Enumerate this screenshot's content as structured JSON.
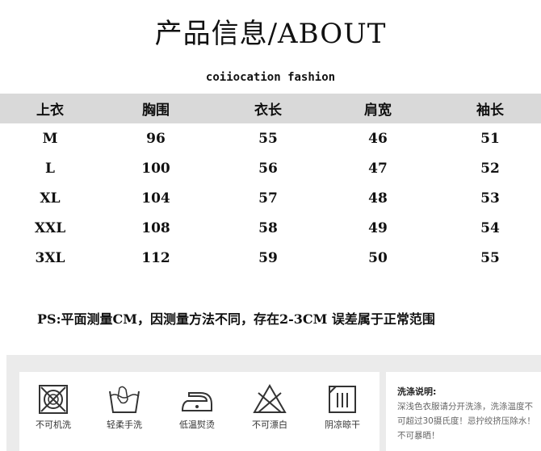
{
  "title": "产品信息/ABOUT",
  "subtitle": "coiiocation fashion",
  "table": {
    "headers": [
      "上衣",
      "胸围",
      "衣长",
      "肩宽",
      "袖长"
    ],
    "rows": [
      [
        "M",
        "96",
        "55",
        "46",
        "51"
      ],
      [
        "L",
        "100",
        "56",
        "47",
        "52"
      ],
      [
        "XL",
        "104",
        "57",
        "48",
        "53"
      ],
      [
        "XXL",
        "108",
        "58",
        "49",
        "54"
      ],
      [
        "3XL",
        "112",
        "59",
        "50",
        "55"
      ]
    ]
  },
  "note": "PS:平面测量CM，因测量方法不同，存在2-3CM 误差属于正常范围",
  "care": {
    "icons": [
      {
        "icon": "no-machine-wash-icon",
        "label": "不可机洗"
      },
      {
        "icon": "gentle-hand-wash-icon",
        "label": "轻柔手洗"
      },
      {
        "icon": "low-temp-iron-icon",
        "label": "低温熨烫"
      },
      {
        "icon": "no-bleach-icon",
        "label": "不可漂白"
      },
      {
        "icon": "shade-dry-icon",
        "label": "阴凉晾干"
      }
    ],
    "instructions_title": "洗涤说明:",
    "instructions_text": "深浅色衣服请分开洗涤，洗涤温度不可超过30摄氏度！忌拧绞挤压除水！不可暴晒！"
  }
}
